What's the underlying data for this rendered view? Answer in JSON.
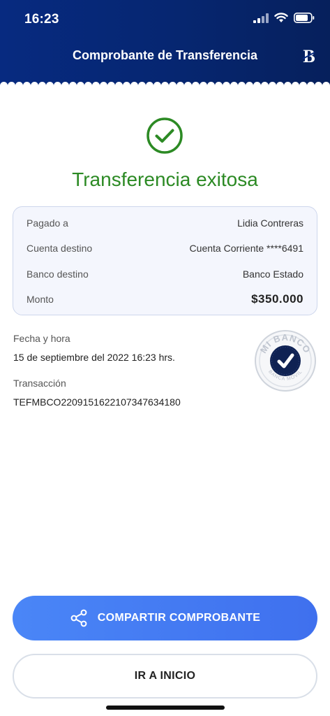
{
  "status_bar": {
    "time": "16:23"
  },
  "header": {
    "title": "Comprobante de Transferencia",
    "logo": "bank-b-logo-icon"
  },
  "success": {
    "icon": "check-circle-icon",
    "title": "Transferencia exitosa",
    "color": "#2c8a24"
  },
  "summary": {
    "rows": [
      {
        "label": "Pagado a",
        "value": "Lidia Contreras"
      },
      {
        "label": "Cuenta destino",
        "value": "Cuenta Corriente ****6491"
      },
      {
        "label": "Banco destino",
        "value": "Banco Estado"
      },
      {
        "label": "Monto",
        "value": "$350.000"
      }
    ]
  },
  "details": {
    "date_label": "Fecha y hora",
    "date_value": "15 de septiembre del 2022 16:23 hrs.",
    "transaction_label": "Transacción",
    "transaction_value": "TEFMBCO220915162210734763418​0"
  },
  "seal": {
    "top_text": "MI BANCO",
    "bottom_text": "BANCA MÓVIL"
  },
  "actions": {
    "share_label": "COMPARTIR COMPROBANTE",
    "home_label": "IR A INICIO"
  },
  "colors": {
    "header": "#062670",
    "primary": "#4a86f7",
    "success": "#2c8a24"
  }
}
